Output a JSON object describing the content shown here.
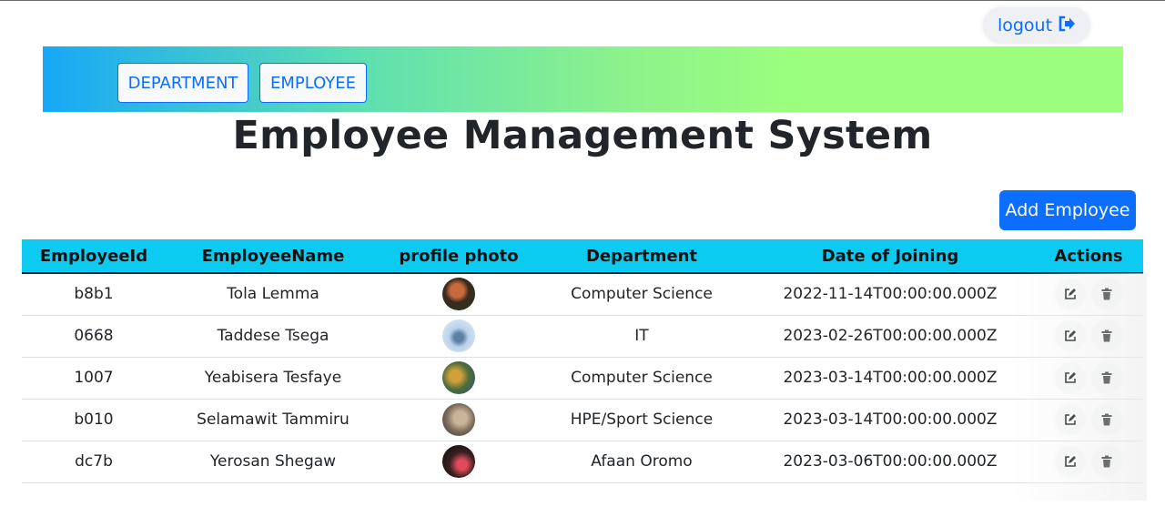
{
  "header": {
    "logout_label": "logout",
    "logout_icon": "sign-out-icon"
  },
  "nav": {
    "department_label": "DEPARTMENT",
    "employee_label": "EMPLOYEE"
  },
  "page": {
    "title": "Employee Management System",
    "add_button_label": "Add Employee"
  },
  "table": {
    "columns": [
      "EmployeeId",
      "EmployeeName",
      "profile photo",
      "Department",
      "Date of Joining",
      "Actions"
    ],
    "rows": [
      {
        "id": "b8b1",
        "name": "Tola Lemma",
        "department": "Computer Science",
        "date": "2022-11-14T00:00:00.000Z"
      },
      {
        "id": "0668",
        "name": "Taddese Tsega",
        "department": "IT",
        "date": "2023-02-26T00:00:00.000Z"
      },
      {
        "id": "1007",
        "name": "Yeabisera Tesfaye",
        "department": "Computer Science",
        "date": "2023-03-14T00:00:00.000Z"
      },
      {
        "id": "b010",
        "name": "Selamawit Tammiru",
        "department": "HPE/Sport Science",
        "date": "2023-03-14T00:00:00.000Z"
      },
      {
        "id": "dc7b",
        "name": "Yerosan Shegaw",
        "department": "Afaan Oromo",
        "date": "2023-03-06T00:00:00.000Z"
      }
    ]
  },
  "icons": {
    "edit": "edit-icon",
    "delete": "trash-icon"
  },
  "colors": {
    "primary": "#0d6efd",
    "table_header": "#0dcaf0",
    "nav_gradient_start": "#17a8f7",
    "nav_gradient_end": "#9bff7d"
  }
}
